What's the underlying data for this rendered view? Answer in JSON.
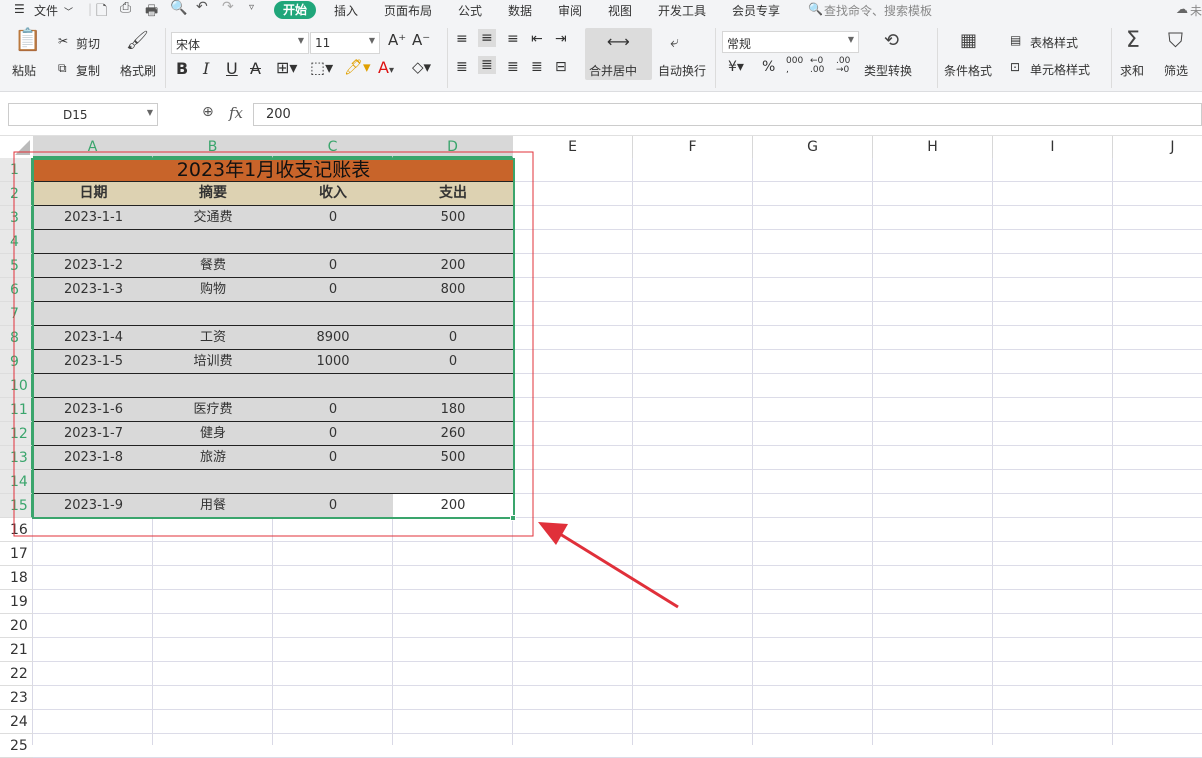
{
  "menu": {
    "file": "文件",
    "tabs": [
      "开始",
      "插入",
      "页面布局",
      "公式",
      "数据",
      "审阅",
      "视图",
      "开发工具",
      "会员专享"
    ],
    "search": "查找命令、搜索模板",
    "right_hint": "未"
  },
  "ribbon": {
    "paste": "粘贴",
    "cut": "剪切",
    "copy": "复制",
    "format_painter": "格式刷",
    "font_name": "宋体",
    "font_size": "11",
    "merge_center": "合并居中",
    "wrap_text": "自动换行",
    "number_format": "常规",
    "percent": "%",
    "type_convert": "类型转换",
    "conditional_format": "条件格式",
    "table_style": "表格样式",
    "cell_style": "单元格样式",
    "sum": "求和",
    "filter": "筛选"
  },
  "formula": {
    "cell_ref": "D15",
    "fx": "fx",
    "value": "200"
  },
  "columns": [
    "A",
    "B",
    "C",
    "D",
    "E",
    "F",
    "G",
    "H",
    "I",
    "J"
  ],
  "rows": [
    "1",
    "2",
    "3",
    "4",
    "5",
    "6",
    "7",
    "8",
    "9",
    "10",
    "11",
    "12",
    "13",
    "14",
    "15",
    "16",
    "17",
    "18",
    "19",
    "20",
    "21",
    "22",
    "23",
    "24",
    "25"
  ],
  "sheet": {
    "title": "2023年1月收支记账表",
    "headers": [
      "日期",
      "摘要",
      "收入",
      "支出"
    ],
    "data": [
      [
        "2023-1-1",
        "交通费",
        "0",
        "500"
      ],
      [
        "",
        "",
        "",
        ""
      ],
      [
        "2023-1-2",
        "餐费",
        "0",
        "200"
      ],
      [
        "2023-1-3",
        "购物",
        "0",
        "800"
      ],
      [
        "",
        "",
        "",
        ""
      ],
      [
        "2023-1-4",
        "工资",
        "8900",
        "0"
      ],
      [
        "2023-1-5",
        "培训费",
        "1000",
        "0"
      ],
      [
        "",
        "",
        "",
        ""
      ],
      [
        "2023-1-6",
        "医疗费",
        "0",
        "180"
      ],
      [
        "2023-1-7",
        "健身",
        "0",
        "260"
      ],
      [
        "2023-1-8",
        "旅游",
        "0",
        "500"
      ],
      [
        "",
        "",
        "",
        ""
      ],
      [
        "2023-1-9",
        "用餐",
        "0",
        "200"
      ]
    ]
  },
  "colors": {
    "accent": "#1fa67a",
    "title_fill": "#c8642a",
    "header_fill": "#ddd2b2",
    "cell_fill": "#d9d9d9",
    "selection": "#3aa56c",
    "annotation": "#e0303a"
  }
}
